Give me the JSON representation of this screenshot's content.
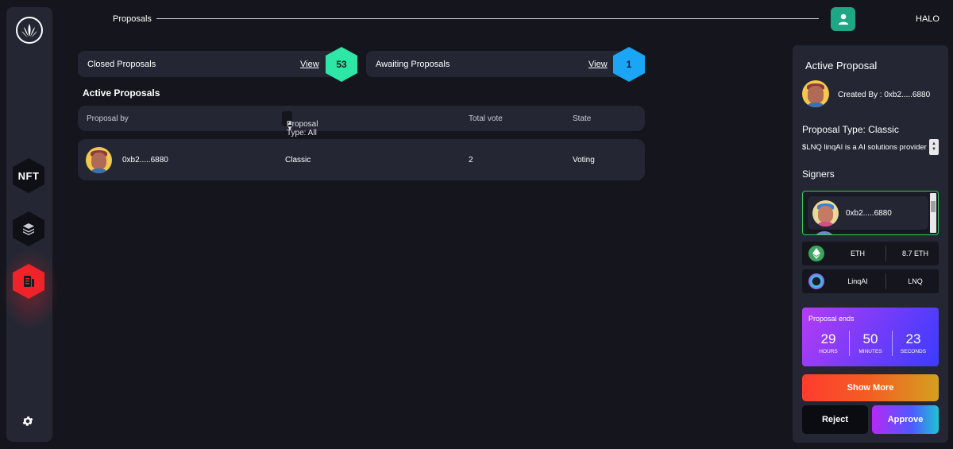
{
  "sidebar": {
    "items": [
      {
        "name": "nft",
        "label": "NFT"
      },
      {
        "name": "layers-icon"
      },
      {
        "name": "proposals-icon",
        "active": true
      },
      {
        "name": "settings-icon"
      }
    ]
  },
  "header": {
    "breadcrumb": "Proposals",
    "user_name": "HALO"
  },
  "stats": {
    "closed": {
      "label": "Closed Proposals",
      "view_label": "View",
      "count": "53",
      "color": "#2ee6a6"
    },
    "awaiting": {
      "label": "Awaiting Proposals",
      "view_label": "View",
      "count": "1",
      "color": "#1aa5f5"
    }
  },
  "main": {
    "section_title": "Active Proposals",
    "table": {
      "headers": {
        "proposal_by": "Proposal by",
        "proposal_type": "Proposal Type: All",
        "total_vote": "Total vote",
        "state": "State"
      },
      "rows": [
        {
          "address": "0xb2.....6880",
          "type": "Classic",
          "votes": "2",
          "state": "Voting"
        }
      ]
    }
  },
  "panel": {
    "title": "Active Proposal",
    "created_by": "Created By : 0xb2.....6880",
    "proposal_type": "Proposal Type: Classic",
    "description": "$LNQ linqAI is a AI solutions provider",
    "signers_title": "Signers",
    "signers": [
      {
        "address": "0xb2.....6880"
      }
    ],
    "tokens": [
      {
        "name": "ETH",
        "value": "8.7 ETH",
        "color": "#3aa55f"
      },
      {
        "name": "LinqAI",
        "value": "LNQ",
        "color": "#2fd4e8"
      }
    ],
    "countdown": {
      "label": "Proposal ends",
      "hours": "29",
      "hours_label": "HOURS",
      "minutes": "50",
      "minutes_label": "MINUTES",
      "seconds": "23",
      "seconds_label": "SECONDS"
    },
    "buttons": {
      "show_more": "Show More",
      "reject": "Reject",
      "approve": "Approve"
    }
  },
  "colors": {
    "background": "#14151d",
    "card": "#242733",
    "accent_green": "#1ea785",
    "accent_red": "#f0232a"
  }
}
